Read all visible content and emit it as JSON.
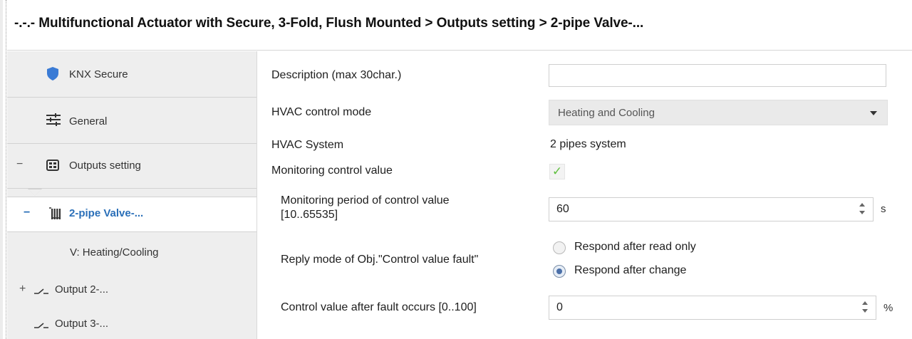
{
  "window": {
    "title": "-.-.- Multifunctional Actuator with Secure, 3-Fold, Flush Mounted > Outputs setting > 2-pipe Valve-..."
  },
  "sidebar": {
    "items": [
      {
        "label": "KNX Secure",
        "icon": "shield-icon"
      },
      {
        "label": "General",
        "icon": "sliders-icon"
      },
      {
        "label": "Outputs setting",
        "icon": "grid-icon",
        "expander": "−"
      },
      {
        "label": "2-pipe Valve-...",
        "icon": "radiator-icon",
        "expander": "−",
        "selected": true
      },
      {
        "label": "V: Heating/Cooling"
      },
      {
        "label": "Output 2-...",
        "icon": "switch-icon",
        "expander": "+"
      },
      {
        "label": "Output 3-...",
        "icon": "switch-icon"
      }
    ]
  },
  "params": {
    "description": {
      "label": "Description (max 30char.)",
      "value": ""
    },
    "hvac_mode": {
      "label": "HVAC control mode",
      "value": "Heating and Cooling"
    },
    "hvac_system": {
      "label": "HVAC System",
      "value": "2 pipes system"
    },
    "monitoring": {
      "label": "Monitoring control value",
      "checked": true,
      "check_glyph": "✓"
    },
    "monitoring_period": {
      "label_line1": "Monitoring period of control value",
      "label_line2": "[10..65535]",
      "value": "60",
      "unit": "s"
    },
    "reply_mode": {
      "label": "Reply mode of Obj.\"Control value fault\"",
      "options": [
        "Respond after read only",
        "Respond after change"
      ],
      "selected": "Respond after change"
    },
    "fault_value": {
      "label": "Control value after fault occurs [0..100]",
      "value": "0",
      "unit": "%"
    }
  },
  "colors": {
    "accent": "#2a6fb8",
    "check": "#5fbf3f",
    "shield": "#3a7bd5",
    "sidebar_bg": "#eeeeee"
  }
}
